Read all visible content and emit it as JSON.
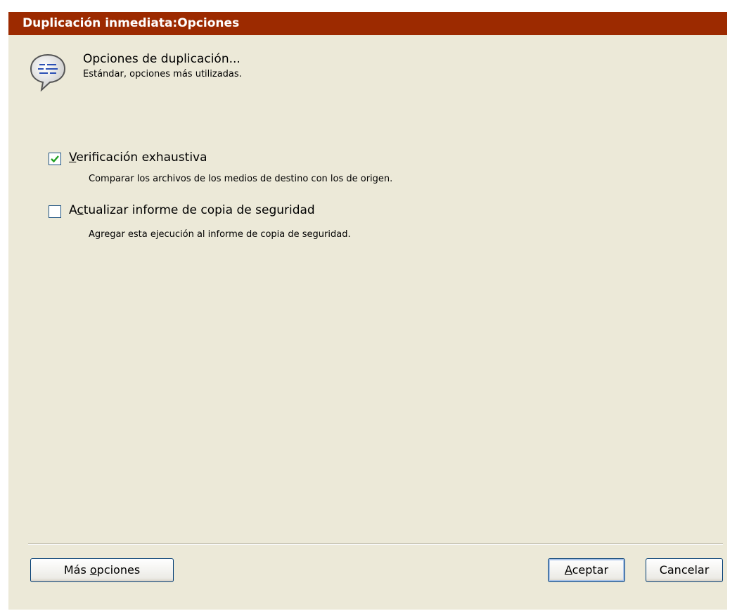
{
  "window": {
    "title": "Duplicación inmediata:Opciones"
  },
  "header": {
    "icon": "speech-bubble-icon",
    "title": "Opciones de duplicación...",
    "subtitle": "Estándar, opciones más utilizadas."
  },
  "options": [
    {
      "label_accel": "V",
      "label_rest": "erificación exhaustiva",
      "description": "Comparar los archivos de los medios de destino con los de origen.",
      "checked": true
    },
    {
      "label_pre": "A",
      "label_accel": "c",
      "label_rest": "tualizar informe de copia de seguridad",
      "description": "Agregar esta ejecución al informe de copia de seguridad.",
      "checked": false
    }
  ],
  "buttons": {
    "more": {
      "pre": "Más ",
      "accel": "o",
      "rest": "pciones"
    },
    "ok": {
      "pre": "",
      "accel": "A",
      "rest": "ceptar"
    },
    "cancel": {
      "label": "Cancelar"
    }
  },
  "colors": {
    "titlebar": "#9c2a00",
    "dialog_bg": "#ece9d8",
    "checkmark": "#21a121"
  }
}
